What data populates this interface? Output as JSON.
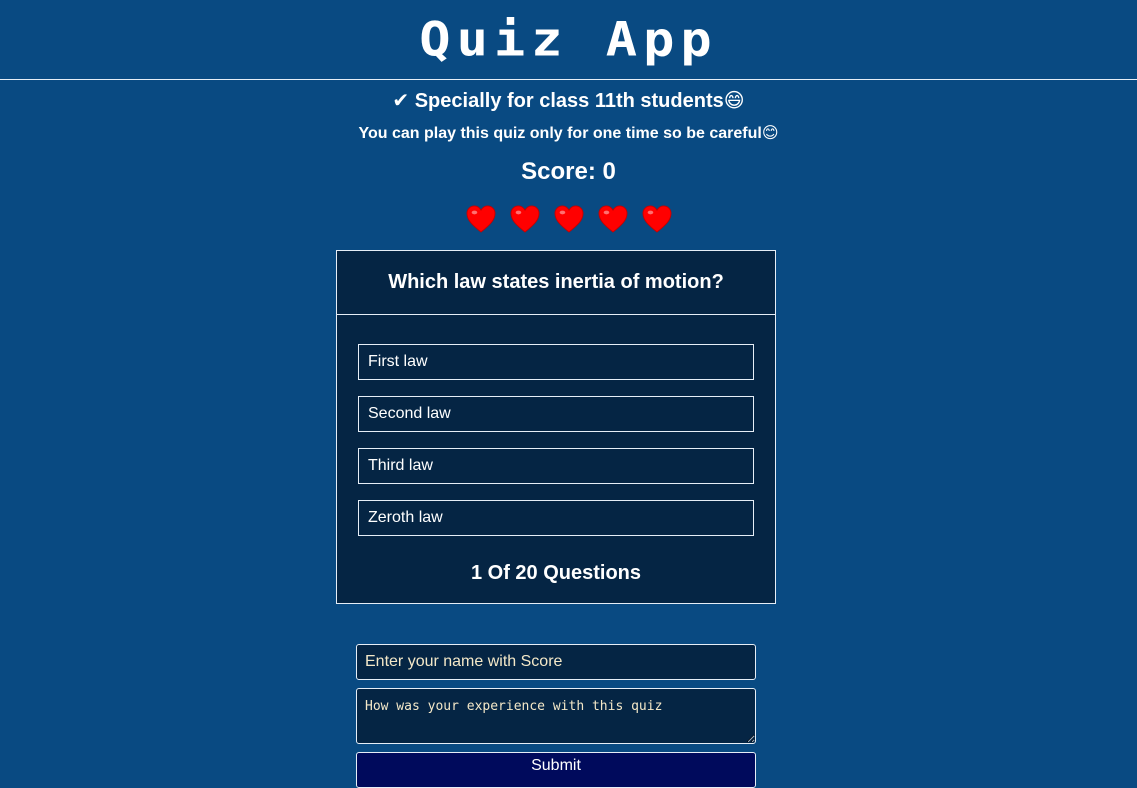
{
  "header": {
    "title": "Quiz App"
  },
  "intro": {
    "subtitle": "✔ Specially for class 11th students😄",
    "warning": "You can play this quiz only for one time so be careful😊"
  },
  "score": {
    "label": "Score: 0",
    "value": 0
  },
  "lives": {
    "count": 5,
    "icon": "heart-icon",
    "color": "#ff0000"
  },
  "quiz": {
    "question": "Which law states inertia of motion?",
    "options": [
      "First law",
      "Second law",
      "Third law",
      "Zeroth law"
    ],
    "progress": "1 Of 20 Questions"
  },
  "form": {
    "name_placeholder": "Enter your name with Score",
    "feedback_placeholder": "How was your experience with this quiz",
    "submit_label": "Submit"
  },
  "colors": {
    "background": "#094a82",
    "card": "#052544",
    "submit": "#000a5c",
    "placeholder": "#f4e8c8"
  }
}
